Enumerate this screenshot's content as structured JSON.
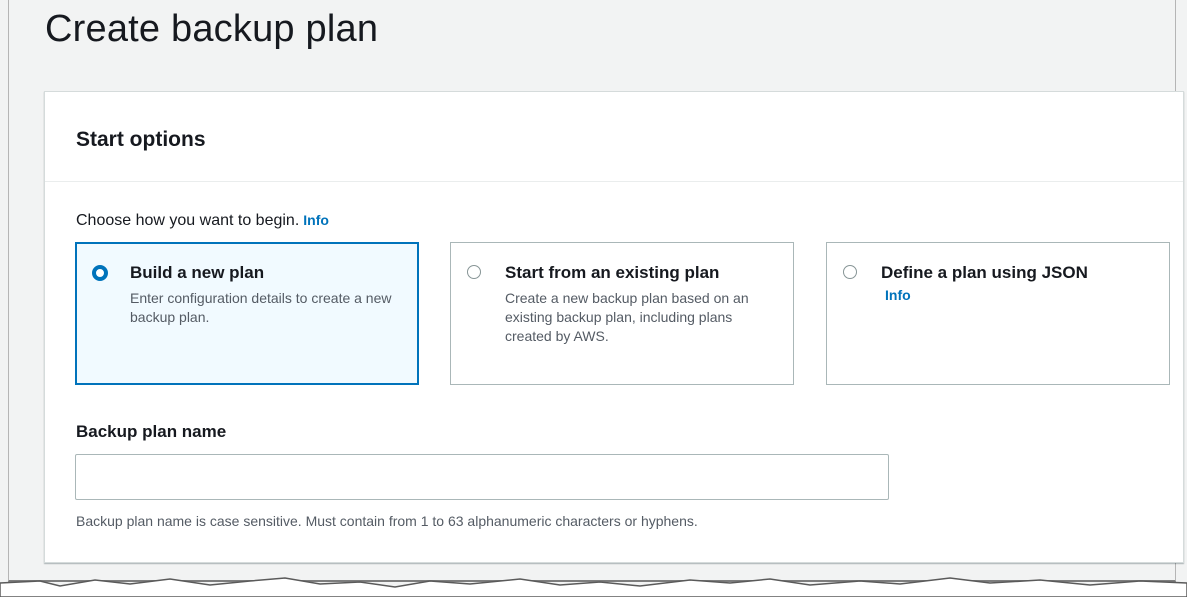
{
  "page": {
    "title": "Create backup plan"
  },
  "start_options": {
    "heading": "Start options",
    "prompt": "Choose how you want to begin.",
    "prompt_info": "Info",
    "options": [
      {
        "label": "Build a new plan",
        "description": "Enter configuration details to create a new backup plan.",
        "selected": true
      },
      {
        "label": "Start from an existing plan",
        "description": "Create a new backup plan based on an existing backup plan, including plans created by AWS.",
        "selected": false
      },
      {
        "label": "Define a plan using JSON",
        "info": "Info",
        "description": "",
        "selected": false
      }
    ]
  },
  "plan_name": {
    "label": "Backup plan name",
    "value": "",
    "placeholder": "",
    "constraint": "Backup plan name is case sensitive. Must contain from 1 to 63 alphanumeric characters or hyphens."
  },
  "colors": {
    "accent": "#0073bb",
    "selected_bg": "#f1faff",
    "border": "#aab7b8"
  }
}
